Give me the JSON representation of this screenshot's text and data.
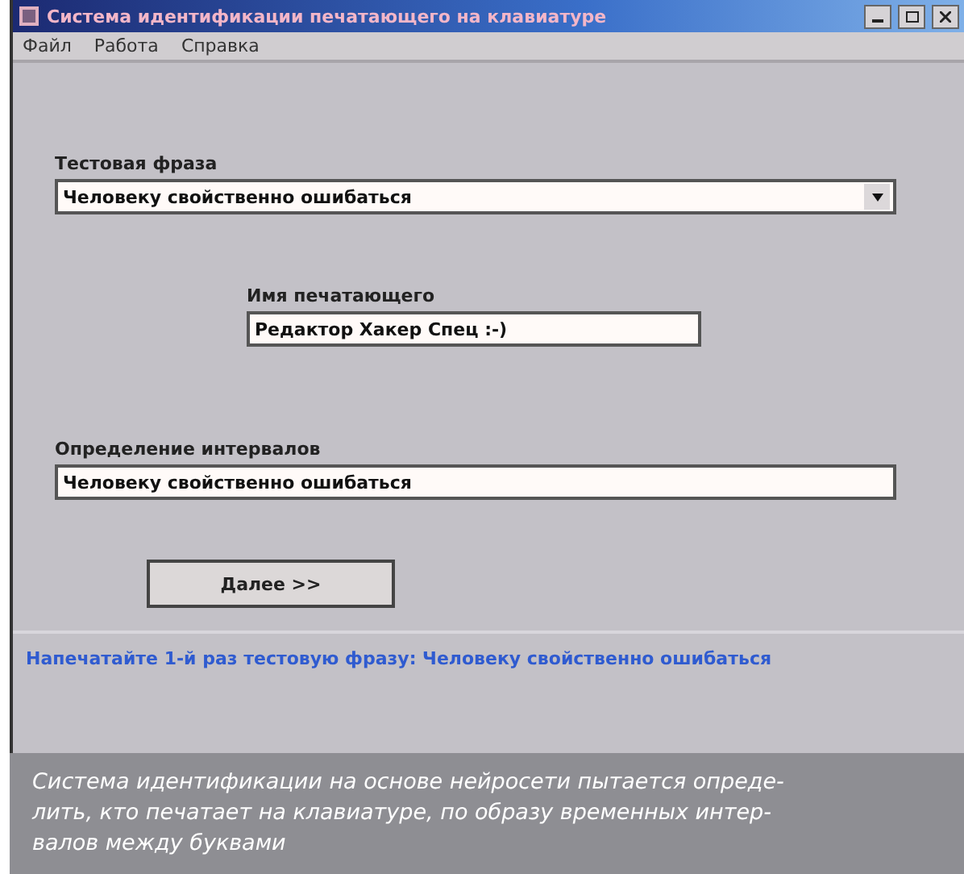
{
  "window": {
    "title": "Система идентификации печатающего на клавиатуре"
  },
  "menu": [
    "Файл",
    "Работа",
    "Справка"
  ],
  "test_phrase": {
    "label": "Тестовая фраза",
    "value": "Человеку свойственно ошибаться"
  },
  "typist_name": {
    "label": "Имя печатающего",
    "value": "Редактор Хакер Спец :-)"
  },
  "intervals": {
    "label": "Определение интервалов",
    "value": "Человеку свойственно ошибаться"
  },
  "next_button": "Далее >>",
  "status_bar": "Напечатайте 1-й раз тестовую фразу: Человеку свойственно ошибаться",
  "caption": [
    "Система идентификации на основе нейросети пытается опреде-",
    "лить, кто печатает на клавиатуре, по образу временных интер-",
    "валов между буквами"
  ]
}
